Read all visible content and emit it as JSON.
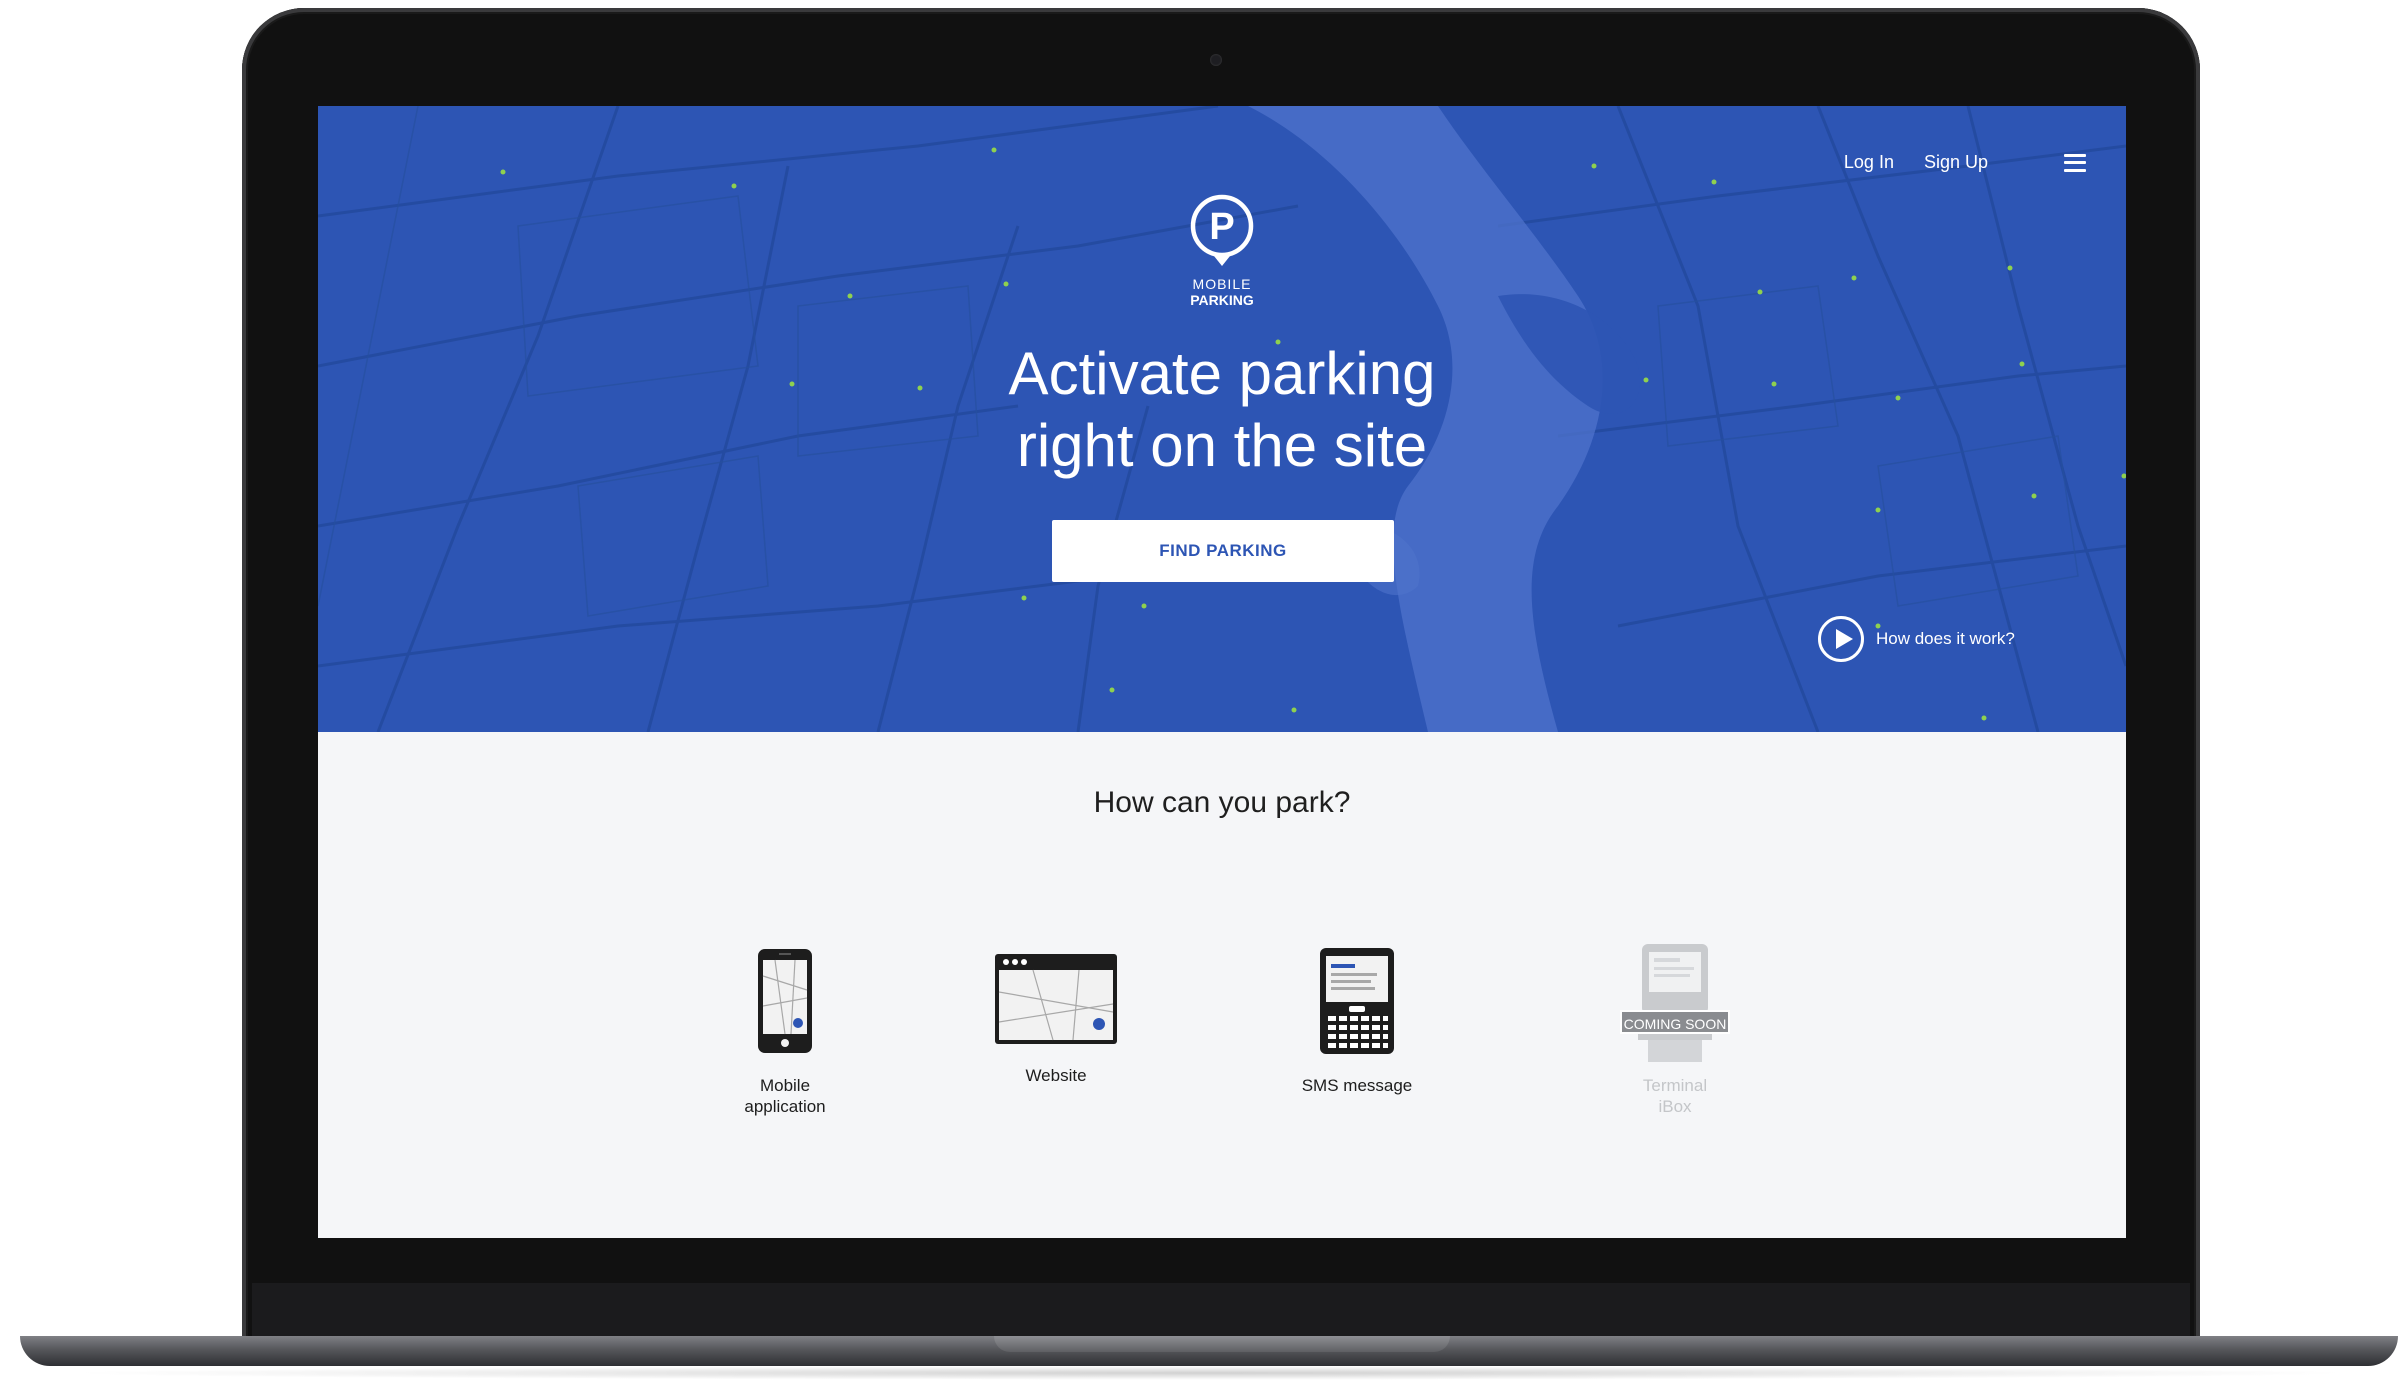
{
  "hero": {
    "logo_line1": "MOBILE",
    "logo_line2": "PARKING",
    "headline_line1": "Activate parking",
    "headline_line2": "right on the site",
    "cta_label": "FIND PARKING",
    "how_it_works": "How does it work?",
    "background_color": "#2d55b4"
  },
  "nav": {
    "login": "Log In",
    "signup": "Sign Up",
    "menu_icon": "hamburger-menu-icon"
  },
  "section": {
    "title": "How can you park?",
    "options": [
      {
        "label_line1": "Mobile",
        "label_line2": "application",
        "icon": "smartphone-map-icon",
        "enabled": true
      },
      {
        "label_line1": "Website",
        "label_line2": "",
        "icon": "browser-map-icon",
        "enabled": true
      },
      {
        "label_line1": "SMS message",
        "label_line2": "",
        "icon": "feature-phone-icon",
        "enabled": true
      },
      {
        "label_line1": "Terminal",
        "label_line2": "iBox",
        "icon": "terminal-kiosk-icon",
        "enabled": false,
        "badge": "COMING SOON"
      }
    ]
  },
  "colors": {
    "accent": "#2d55b4",
    "map_dots": "#8fd14f",
    "section_bg": "#f5f6f8"
  }
}
